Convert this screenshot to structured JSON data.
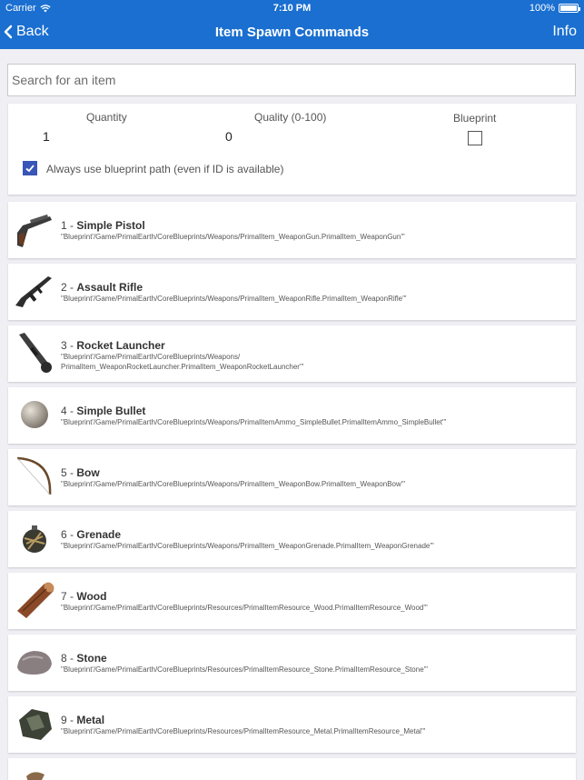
{
  "status_bar": {
    "carrier": "Carrier",
    "time": "7:10 PM",
    "battery": "100%"
  },
  "nav": {
    "back_label": "Back",
    "title": "Item Spawn Commands",
    "info_label": "Info"
  },
  "search": {
    "placeholder": "Search for an item",
    "value": ""
  },
  "settings": {
    "quantity_label": "Quantity",
    "quantity_value": "1",
    "quality_label": "Quality (0-100)",
    "quality_value": "0",
    "blueprint_label": "Blueprint",
    "always_blueprint_label": "Always use blueprint path (even if ID is available)"
  },
  "items": [
    {
      "num": "1 -",
      "name": "Simple Pistol",
      "path1": "\"Blueprint'/Game/PrimalEarth/CoreBlueprints/Weapons/PrimalItem_WeaponGun.PrimalItem_WeaponGun'\"",
      "path2": "",
      "icon": "pistol-icon"
    },
    {
      "num": "2 -",
      "name": "Assault Rifle",
      "path1": "\"Blueprint'/Game/PrimalEarth/CoreBlueprints/Weapons/PrimalItem_WeaponRifle.PrimalItem_WeaponRifle'\"",
      "path2": "",
      "icon": "rifle-icon"
    },
    {
      "num": "3 -",
      "name": "Rocket Launcher",
      "path1": "\"Blueprint'/Game/PrimalEarth/CoreBlueprints/Weapons/",
      "path2": "PrimalItem_WeaponRocketLauncher.PrimalItem_WeaponRocketLauncher'\"",
      "icon": "rocket-launcher-icon"
    },
    {
      "num": "4 -",
      "name": "Simple Bullet",
      "path1": "\"Blueprint'/Game/PrimalEarth/CoreBlueprints/Weapons/PrimalItemAmmo_SimpleBullet.PrimalItemAmmo_SimpleBullet'\"",
      "path2": "",
      "icon": "bullet-icon"
    },
    {
      "num": "5 -",
      "name": "Bow",
      "path1": "\"Blueprint'/Game/PrimalEarth/CoreBlueprints/Weapons/PrimalItem_WeaponBow.PrimalItem_WeaponBow'\"",
      "path2": "",
      "icon": "bow-icon"
    },
    {
      "num": "6 -",
      "name": "Grenade",
      "path1": "\"Blueprint'/Game/PrimalEarth/CoreBlueprints/Weapons/PrimalItem_WeaponGrenade.PrimalItem_WeaponGrenade'\"",
      "path2": "",
      "icon": "grenade-icon"
    },
    {
      "num": "7 -",
      "name": "Wood",
      "path1": "\"Blueprint'/Game/PrimalEarth/CoreBlueprints/Resources/PrimalItemResource_Wood.PrimalItemResource_Wood'\"",
      "path2": "",
      "icon": "wood-icon"
    },
    {
      "num": "8 -",
      "name": "Stone",
      "path1": "\"Blueprint'/Game/PrimalEarth/CoreBlueprints/Resources/PrimalItemResource_Stone.PrimalItemResource_Stone'\"",
      "path2": "",
      "icon": "stone-icon"
    },
    {
      "num": "9 -",
      "name": "Metal",
      "path1": "\"Blueprint'/Game/PrimalEarth/CoreBlueprints/Resources/PrimalItemResource_Metal.PrimalItemResource_Metal'\"",
      "path2": "",
      "icon": "metal-icon"
    }
  ]
}
